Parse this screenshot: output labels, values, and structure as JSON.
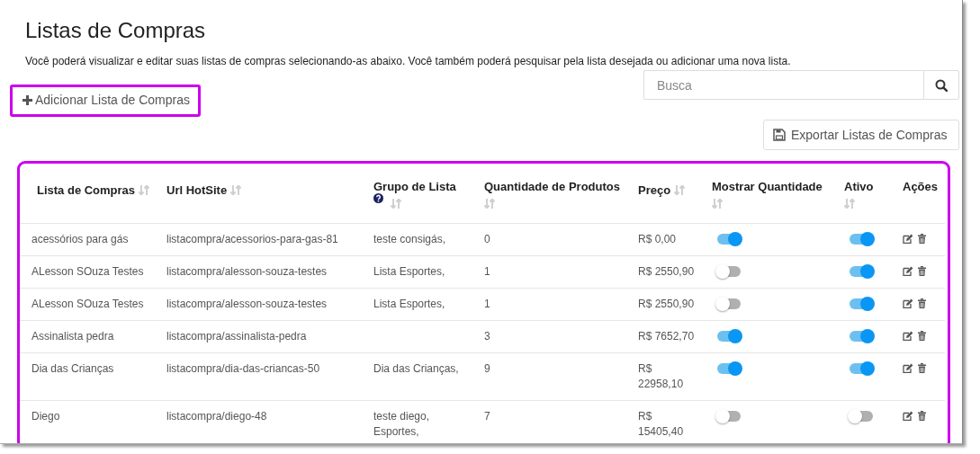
{
  "page": {
    "title": "Listas de Compras",
    "description": "Você poderá visualizar e editar suas listas de compras selecionando-as abaixo. Você também poderá pesquisar pela lista desejada ou adicionar uma nova lista."
  },
  "add_button": {
    "label": "Adicionar Lista de Compras"
  },
  "search": {
    "placeholder": "Busca"
  },
  "export_button": {
    "label": "Exportar Listas de Compras"
  },
  "table": {
    "columns": [
      {
        "label": "Lista de Compras",
        "sortable": true,
        "help": false
      },
      {
        "label": "Url HotSite",
        "sortable": true,
        "help": false
      },
      {
        "label": "Grupo de Lista",
        "sortable": true,
        "help": true
      },
      {
        "label": "Quantidade de Produtos",
        "sortable": true,
        "help": false
      },
      {
        "label": "Preço",
        "sortable": true,
        "help": false
      },
      {
        "label": "Mostrar Quantidade",
        "sortable": true,
        "help": false
      },
      {
        "label": "Ativo",
        "sortable": true,
        "help": false
      },
      {
        "label": "Ações",
        "sortable": false,
        "help": false
      }
    ],
    "rows": [
      {
        "name": "acessórios para gás",
        "url": "listacompra/acessorios-para-gas-81",
        "group": "teste consigás,",
        "quantity": "0",
        "price": "R$ 0,00",
        "show_quantity": true,
        "active": true
      },
      {
        "name": "ALesson SOuza Testes",
        "url": "listacompra/alesson-souza-testes",
        "group": "Lista Esportes,",
        "quantity": "1",
        "price": "R$ 2550,90",
        "show_quantity": false,
        "active": true
      },
      {
        "name": "ALesson SOuza Testes",
        "url": "listacompra/alesson-souza-testes",
        "group": "Lista Esportes,",
        "quantity": "1",
        "price": "R$ 2550,90",
        "show_quantity": false,
        "active": true
      },
      {
        "name": "Assinalista pedra",
        "url": "listacompra/assinalista-pedra",
        "quantity": "3",
        "price": "R$ 7652,70",
        "show_quantity": true,
        "active": true
      },
      {
        "name": "Dia das Crianças",
        "url": "listacompra/dia-das-criancas-50",
        "group": "Dia das Crianças,",
        "quantity": "9",
        "price": "R$ 22958,10",
        "show_quantity": true,
        "active": true
      },
      {
        "name": "Diego",
        "url": "listacompra/diego-48",
        "group": "teste diego, Esportes,",
        "quantity": "7",
        "price": "R$ 15405,40",
        "show_quantity": false,
        "active": false
      }
    ]
  }
}
